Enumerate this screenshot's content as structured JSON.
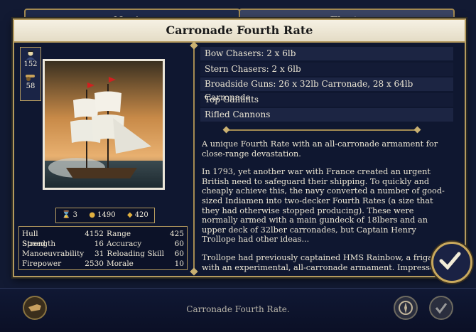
{
  "tabs": [
    {
      "label": "Navies"
    },
    {
      "label": "Fleets"
    }
  ],
  "ship": {
    "title": "Carronade Fourth Rate",
    "crew": "152",
    "guns": "58",
    "resources": {
      "a": "3",
      "b": "1490",
      "c": "420"
    },
    "stats_left": [
      {
        "label": "Hull Strength",
        "value": "4152"
      },
      {
        "label": "Speed",
        "value": "16"
      },
      {
        "label": "Manoeuvrability",
        "value": "31"
      },
      {
        "label": "Firepower",
        "value": "2530"
      }
    ],
    "stats_right": [
      {
        "label": "Range",
        "value": "425"
      },
      {
        "label": "Accuracy",
        "value": "60"
      },
      {
        "label": "Reloading Skill",
        "value": "60"
      },
      {
        "label": "Morale",
        "value": "10"
      }
    ],
    "equipment": [
      "Bow Chasers: 2 x 6lb",
      "Stern Chasers: 2 x 6lb",
      "Broadside Guns: 26 x 32lb Carronade, 28 x 64lb Carronade",
      "Top Gallants",
      "Rifled Cannons"
    ],
    "description": [
      "A unique Fourth Rate with an all-carronade armament for close-range devastation.",
      "In 1793, yet another war with France created an urgent British need to safeguard their shipping. To quickly and cheaply achieve this, the navy converted a number of good-sized Indiamen into two-decker Fourth Rates (a size that they had otherwise stopped producing). These were normally armed with a main gundeck of 18lbers and an upper deck of 32lber carronades, but Captain Henry Trollope had other ideas...",
      "Trollope had previously captained HMS Rainbow, a frigate with an experimental, all-carronade armament. Impressed by its"
    ]
  },
  "footer": {
    "caption": "Carronade Fourth Rate."
  },
  "icons": {
    "crew": "crew-icon",
    "guns": "cannon-icon",
    "hourglass": "hourglass-icon",
    "gold": "gold-icon",
    "upkeep": "upkeep-icon",
    "back": "pointing-hand-icon",
    "compass": "compass-icon",
    "confirm": "checkmark-icon"
  },
  "colors": {
    "accent": "#b49a5e",
    "panel": "#0f1730",
    "title_bg": "#f2ecdd"
  }
}
